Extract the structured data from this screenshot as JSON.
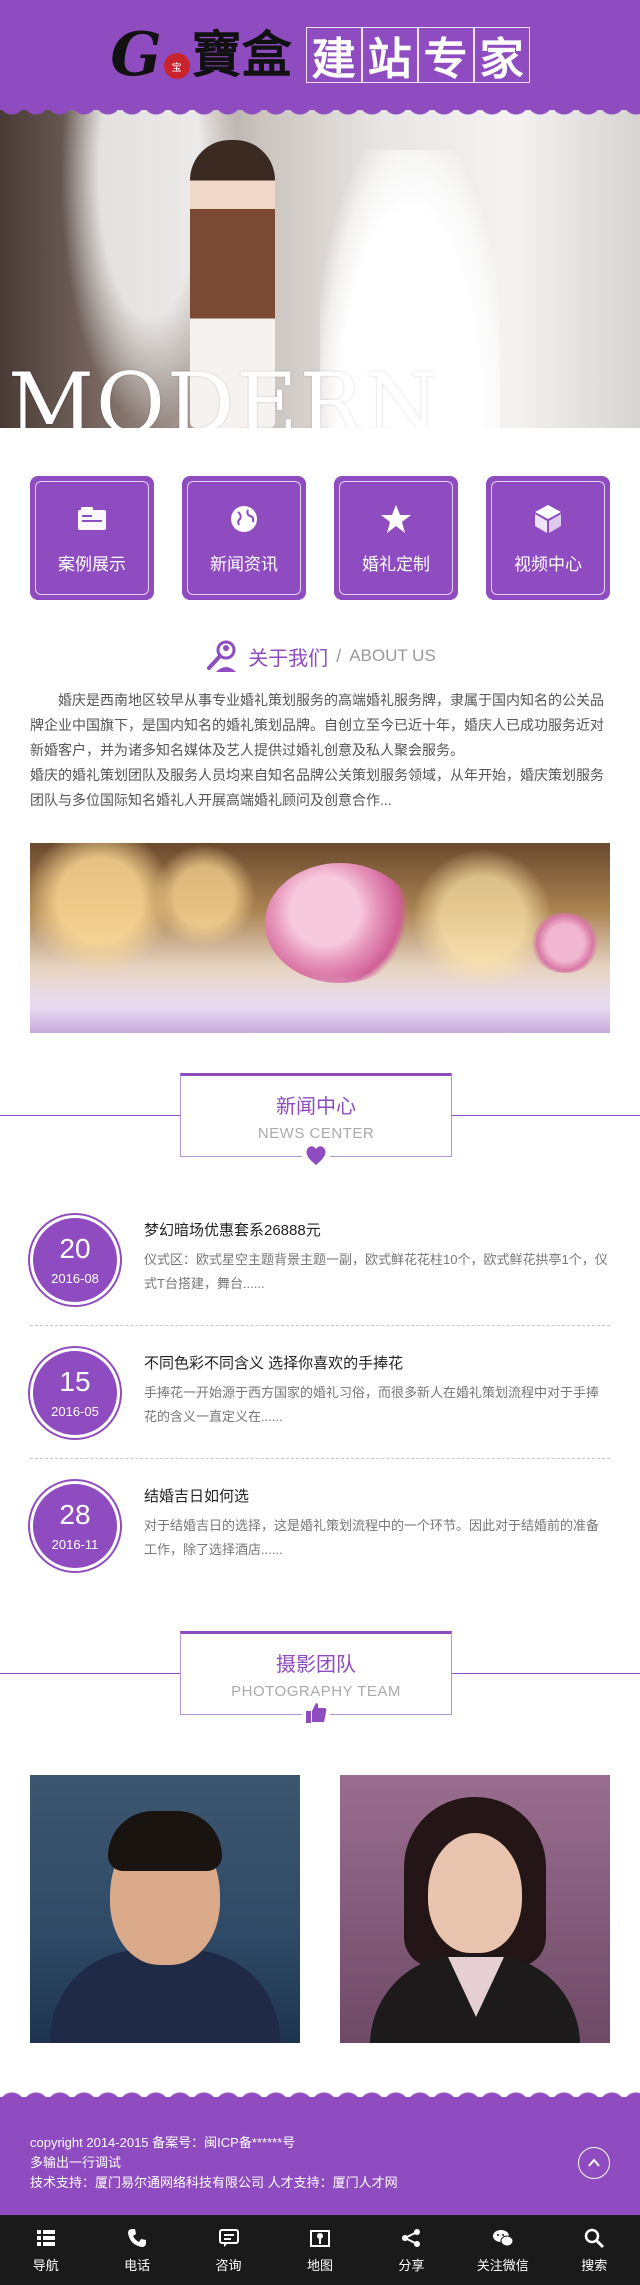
{
  "brand": {
    "logo_letter": "G",
    "logo_seal": "宝",
    "logo_name": "寶盒",
    "slogan": [
      "建",
      "站",
      "专",
      "家"
    ]
  },
  "banner": {
    "overlay_text": "MODERN"
  },
  "quick_nav": [
    {
      "label": "案例展示",
      "icon": "folder-icon"
    },
    {
      "label": "新闻资讯",
      "icon": "globe-icon"
    },
    {
      "label": "婚礼定制",
      "icon": "star-icon"
    },
    {
      "label": "视频中心",
      "icon": "cube-icon"
    }
  ],
  "about": {
    "title": "关于我们",
    "separator": "/",
    "subtitle": "ABOUT US",
    "paragraph1": "婚庆是西南地区较早从事专业婚礼策划服务的高端婚礼服务牌，隶属于国内知名的公关品牌企业中国旗下，是国内知名的婚礼策划品牌。自创立至今已近十年，婚庆人已成功服务近对新婚客户，并为诸多知名媒体及艺人提供过婚礼创意及私人聚会服务。",
    "paragraph2": "婚庆的婚礼策划团队及服务人员均来自知名品牌公关策划服务领域，从年开始，婚庆策划服务团队与多位国际知名婚礼人开展高端婚礼顾问及创意合作..."
  },
  "news": {
    "title_cn": "新闻中心",
    "title_en": "NEWS CENTER",
    "items": [
      {
        "day": "20",
        "ym": "2016-08",
        "title": "梦幻暗场优惠套系26888元",
        "desc": "仪式区：欧式星空主题背景主题一副，欧式鲜花花柱10个，欧式鲜花拱亭1个，仪式T台搭建，舞台......"
      },
      {
        "day": "15",
        "ym": "2016-05",
        "title": "不同色彩不同含义 选择你喜欢的手捧花",
        "desc": "手捧花一开始源于西方国家的婚礼习俗，而很多新人在婚礼策划流程中对于手捧花的含义一直定义在......"
      },
      {
        "day": "28",
        "ym": "2016-11",
        "title": "结婚吉日如何选",
        "desc": "对于结婚吉日的选择，这是婚礼策划流程中的一个环节。因此对于结婚前的准备工作，除了选择酒店......"
      }
    ]
  },
  "team": {
    "title_cn": "摄影团队",
    "title_en": "PHOTOGRAPHY TEAM"
  },
  "footer": {
    "line1": "copyright 2014-2015 备案号：闽ICP备******号",
    "line2": "多输出一行调试",
    "line3": "技术支持：厦门易尔通网络科技有限公司 人才支持：厦门人才网"
  },
  "tabbar": [
    {
      "label": "导航",
      "icon": "menu-icon"
    },
    {
      "label": "电话",
      "icon": "phone-icon"
    },
    {
      "label": "咨询",
      "icon": "chat-icon"
    },
    {
      "label": "地图",
      "icon": "map-icon"
    },
    {
      "label": "分享",
      "icon": "share-icon"
    },
    {
      "label": "关注微信",
      "icon": "wechat-icon"
    },
    {
      "label": "搜索",
      "icon": "search-icon"
    }
  ],
  "colors": {
    "accent": "#8f4cc0",
    "tabbar": "#1a1a1a"
  }
}
